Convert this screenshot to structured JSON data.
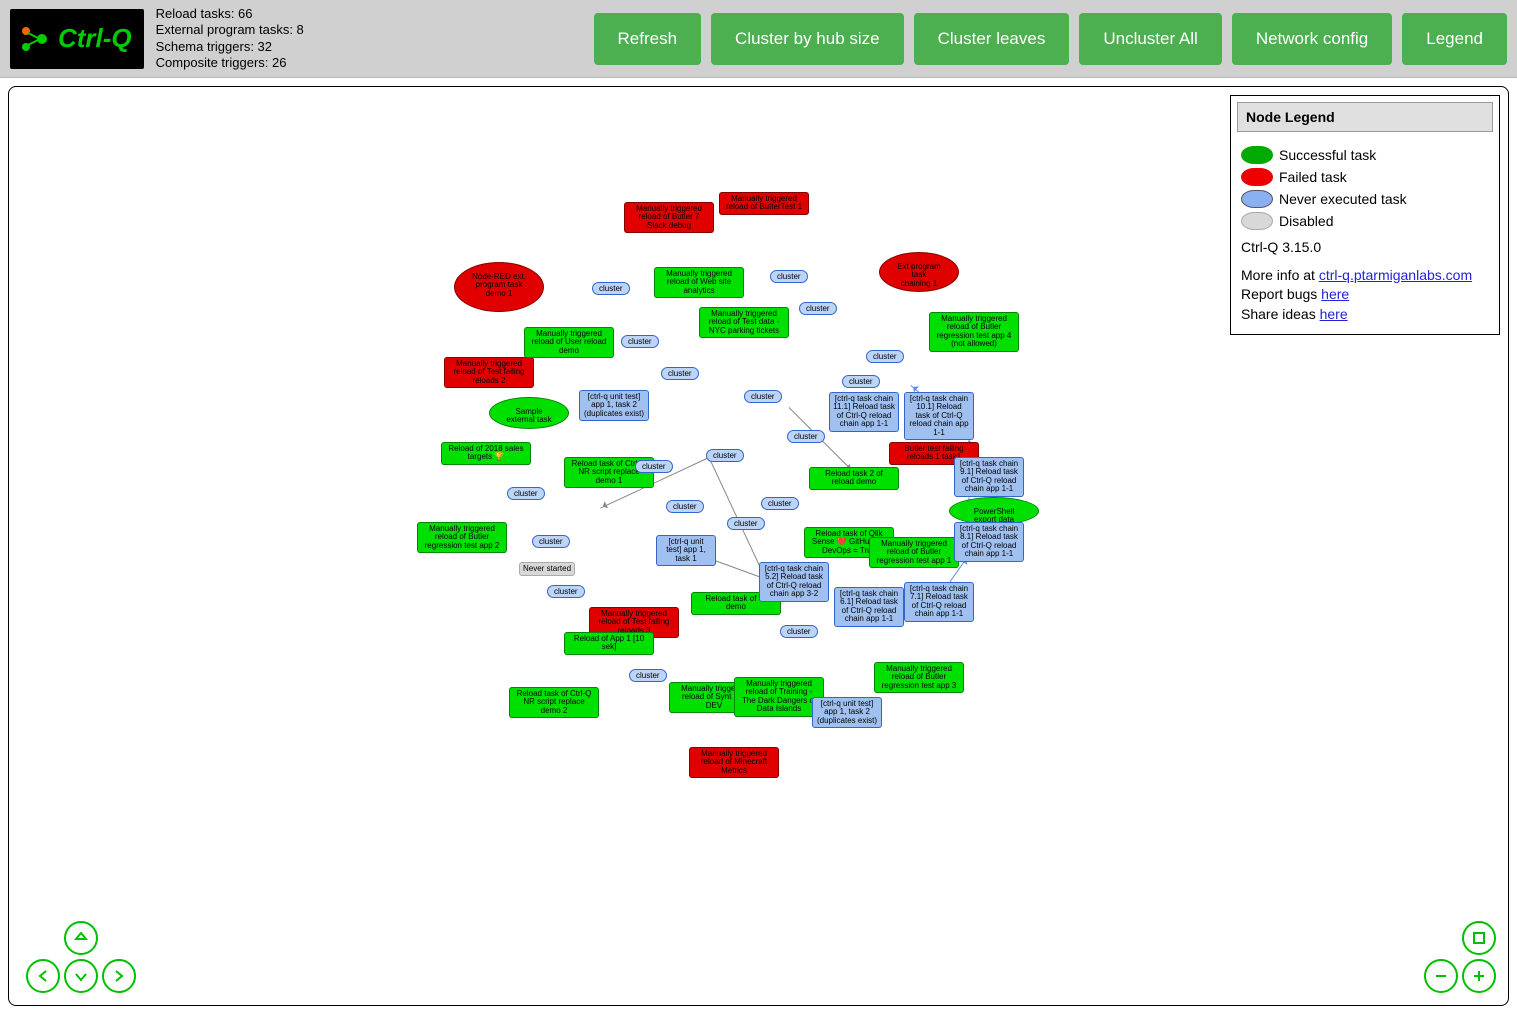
{
  "header": {
    "brand": "Ctrl-Q",
    "stats": {
      "reload_tasks": "Reload tasks: 66",
      "ext_prog_tasks": "External program tasks: 8",
      "schema_triggers": "Schema triggers: 32",
      "composite_triggers": "Composite triggers: 26"
    },
    "buttons": {
      "refresh": "Refresh",
      "cluster_hub": "Cluster by hub size",
      "cluster_leaves": "Cluster leaves",
      "uncluster": "Uncluster All",
      "net_config": "Network config",
      "legend": "Legend"
    }
  },
  "legend": {
    "title": "Node Legend",
    "items": {
      "success": "Successful task",
      "failed": "Failed task",
      "never": "Never executed task",
      "disabled": "Disabled"
    },
    "version": "Ctrl-Q 3.15.0",
    "more_info_pre": "More info at ",
    "more_info_link": "ctrl-q.ptarmiganlabs.com",
    "bugs_pre": "Report bugs ",
    "bugs_link": "here",
    "ideas_pre": "Share ideas ",
    "ideas_link": "here"
  },
  "clusters_label": "cluster",
  "nodes": {
    "never_started": "Never started",
    "red_ellipse_left": "Node-RED ext. program task demo 1",
    "red_ellipse_right": "Ext program task chaining 1",
    "green_ellipse": "Sample external task",
    "red1": "Manually triggered reload of ButterTest 1",
    "red2": "Manually triggered reload of Butler 7 Slack debug",
    "red3": "Manually triggered reload of Test failing reloads 2",
    "red4": "Manually triggered reload of Test failing reloads 3",
    "red5": "Manually triggered reload of Minecraft Metrics",
    "red6": "Butler test failing reloads 1 task1",
    "g_web": "Manually triggered reload of Web site analytics",
    "g_user": "Manually triggered reload of User reload demo",
    "g_nyc": "Manually triggered reload of Test data - NYC parking tickets",
    "g_butler4": "Manually triggered reload of Butler regression test app 4 (not allowed)",
    "g_reload2018": "Reload of 2018 sales targets 🏆",
    "g_nr1": "Reload task of Ctrl-Q NR script replace demo 1",
    "g_nr2": "Reload task of Ctrl-Q NR script replace demo 2",
    "g_butler2": "Manually triggered reload of Butler regression test app 2",
    "g_ci": "Reload task of CI demo",
    "g_app1": "Reload of App 1 [10 sek]",
    "g_synt": "Manually triggered reload of Synt key DEV",
    "g_training": "Manually triggered reload of Training - The Dark Dangers of Data Islands",
    "g_butler3": "Manually triggered reload of Butler regression test app 3",
    "g_qlik": "Reload task of Qlik Sense ❤️ GitHub ❤️ DevOps = True",
    "g_butler1": "Manually triggered reload of Butler regression test app 1",
    "g_reload2": "Reload task 2 of reload demo",
    "g_ps": "PowerShell export data connections",
    "b_unit12a": "[ctrl-q unit test] app 1, task 2 (duplicates exist)",
    "b_unit11": "[ctrl-q unit test] app 1, task 1",
    "b_unit12b": "[ctrl-q unit test] app 1, task 2 (duplicates exist)",
    "b_tc52": "[ctrl-q task chain 5.2] Reload task of Ctrl-Q reload chain app 3-2",
    "b_tc61": "[ctrl-q task chain 6.1] Reload task of Ctrl-Q reload chain app 1-1",
    "b_tc71": "[ctrl-q task chain 7.1] Reload task of Ctrl-Q reload chain app 1-1",
    "b_tc81": "[ctrl-q task chain 8.1] Reload task of Ctrl-Q reload chain app 1-1",
    "b_tc91": "[ctrl-q task chain 9.1] Reload task of Ctrl-Q reload chain app 1-1",
    "b_tc101": "[ctrl-q task chain 10.1] Reload task of Ctrl-Q reload chain app 1-1",
    "b_tc111": "[ctrl-q task chain 11.1] Reload task of Ctrl-Q reload chain app 1-1"
  }
}
